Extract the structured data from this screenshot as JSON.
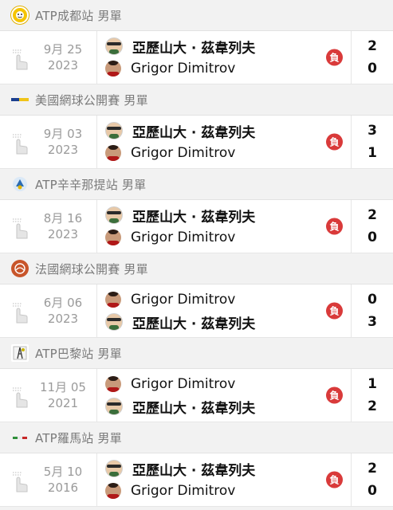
{
  "groups": [
    {
      "tournament": "ATP成都站 男單",
      "logo": "chengdu-logo",
      "logo_color": "#f5c400",
      "date_md": "9月 25",
      "date_year": "2023",
      "players": [
        {
          "name": "亞歷山大 · 茲韋列夫",
          "avatar": "zverev",
          "score": "2"
        },
        {
          "name": "Grigor Dimitrov",
          "avatar": "dimitrov",
          "score": "0"
        }
      ],
      "result": "負"
    },
    {
      "tournament": "美國網球公開賽 男單",
      "logo": "us-open-logo",
      "logo_color": "#1b3f8f",
      "date_md": "9月 03",
      "date_year": "2023",
      "players": [
        {
          "name": "亞歷山大 · 茲韋列夫",
          "avatar": "zverev",
          "score": "3"
        },
        {
          "name": "Grigor Dimitrov",
          "avatar": "dimitrov",
          "score": "1"
        }
      ],
      "result": "負"
    },
    {
      "tournament": "ATP辛辛那提站 男單",
      "logo": "cincinnati-logo",
      "logo_color": "#2b6cb3",
      "date_md": "8月 16",
      "date_year": "2023",
      "players": [
        {
          "name": "亞歷山大 · 茲韋列夫",
          "avatar": "zverev",
          "score": "2"
        },
        {
          "name": "Grigor Dimitrov",
          "avatar": "dimitrov",
          "score": "0"
        }
      ],
      "result": "負"
    },
    {
      "tournament": "法國網球公開賽 男單",
      "logo": "roland-garros-logo",
      "logo_color": "#c8552a",
      "date_md": "6月 06",
      "date_year": "2023",
      "players": [
        {
          "name": "Grigor Dimitrov",
          "avatar": "dimitrov",
          "score": "0"
        },
        {
          "name": "亞歷山大 · 茲韋列夫",
          "avatar": "zverev",
          "score": "3"
        }
      ],
      "result": "負"
    },
    {
      "tournament": "ATP巴黎站 男單",
      "logo": "paris-logo",
      "logo_color": "#3a3a3a",
      "date_md": "11月 05",
      "date_year": "2021",
      "players": [
        {
          "name": "Grigor Dimitrov",
          "avatar": "dimitrov",
          "score": "1"
        },
        {
          "name": "亞歷山大 · 茲韋列夫",
          "avatar": "zverev",
          "score": "2"
        }
      ],
      "result": "負"
    },
    {
      "tournament": "ATP羅馬站 男單",
      "logo": "rome-logo",
      "logo_color": "#2f8f3a",
      "date_md": "5月 10",
      "date_year": "2016",
      "players": [
        {
          "name": "亞歷山大 · 茲韋列夫",
          "avatar": "zverev",
          "score": "2"
        },
        {
          "name": "Grigor Dimitrov",
          "avatar": "dimitrov",
          "score": "0"
        }
      ],
      "result": "負"
    }
  ],
  "colors": {
    "loss_badge": "#d93a3a",
    "header_text": "#7a7a7a",
    "date_text": "#9a9a9a"
  }
}
